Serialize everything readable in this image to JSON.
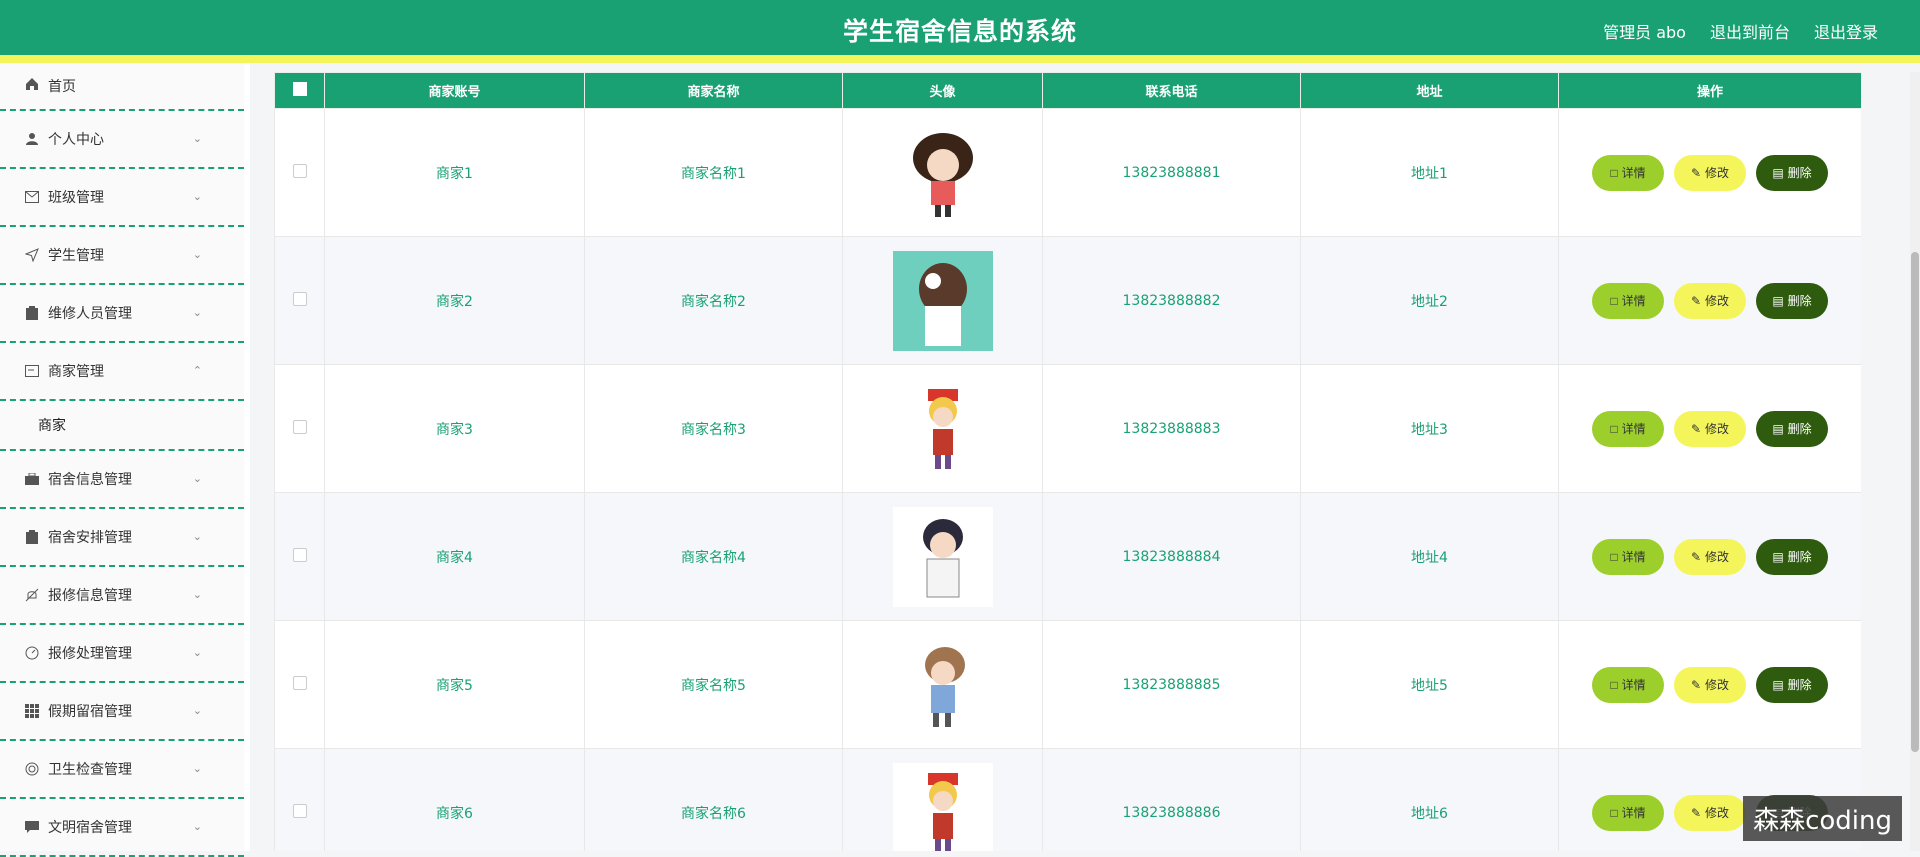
{
  "header": {
    "title": "学生宿舍信息的系统",
    "user": "管理员 abo",
    "back_front": "退出到前台",
    "logout": "退出登录"
  },
  "sidebar": {
    "items": [
      {
        "label": "首页",
        "icon": "home-icon"
      },
      {
        "label": "个人中心",
        "icon": "user-icon"
      },
      {
        "label": "班级管理",
        "icon": "mail-icon"
      },
      {
        "label": "学生管理",
        "icon": "send-icon"
      },
      {
        "label": "维修人员管理",
        "icon": "clipboard-icon"
      },
      {
        "label": "商家管理",
        "icon": "card-icon",
        "expanded": true
      },
      {
        "label": "宿舍信息管理",
        "icon": "briefcase-icon"
      },
      {
        "label": "宿舍安排管理",
        "icon": "clipboard-icon"
      },
      {
        "label": "报修信息管理",
        "icon": "bell-off-icon"
      },
      {
        "label": "报修处理管理",
        "icon": "gauge-icon"
      },
      {
        "label": "假期留宿管理",
        "icon": "grid-icon"
      },
      {
        "label": "卫生检查管理",
        "icon": "lifebuoy-icon"
      },
      {
        "label": "文明宿舍管理",
        "icon": "chat-icon"
      }
    ],
    "submenu_label": "商家"
  },
  "table": {
    "columns": [
      "商家账号",
      "商家名称",
      "头像",
      "联系电话",
      "地址",
      "操作"
    ],
    "rows": [
      {
        "account": "商家1",
        "name": "商家名称1",
        "phone": "13823888881",
        "address": "地址1"
      },
      {
        "account": "商家2",
        "name": "商家名称2",
        "phone": "13823888882",
        "address": "地址2"
      },
      {
        "account": "商家3",
        "name": "商家名称3",
        "phone": "13823888883",
        "address": "地址3"
      },
      {
        "account": "商家4",
        "name": "商家名称4",
        "phone": "13823888884",
        "address": "地址4"
      },
      {
        "account": "商家5",
        "name": "商家名称5",
        "phone": "13823888885",
        "address": "地址5"
      },
      {
        "account": "商家6",
        "name": "商家名称6",
        "phone": "13823888886",
        "address": "地址6"
      }
    ],
    "actions": {
      "detail": "详情",
      "edit": "修改",
      "delete": "删除"
    }
  },
  "watermark": "森森coding",
  "colors": {
    "primary": "#1aa173",
    "accent": "#f3f55a",
    "detail_btn": "#9ccf2c",
    "delete_btn": "#2f5b0f"
  }
}
